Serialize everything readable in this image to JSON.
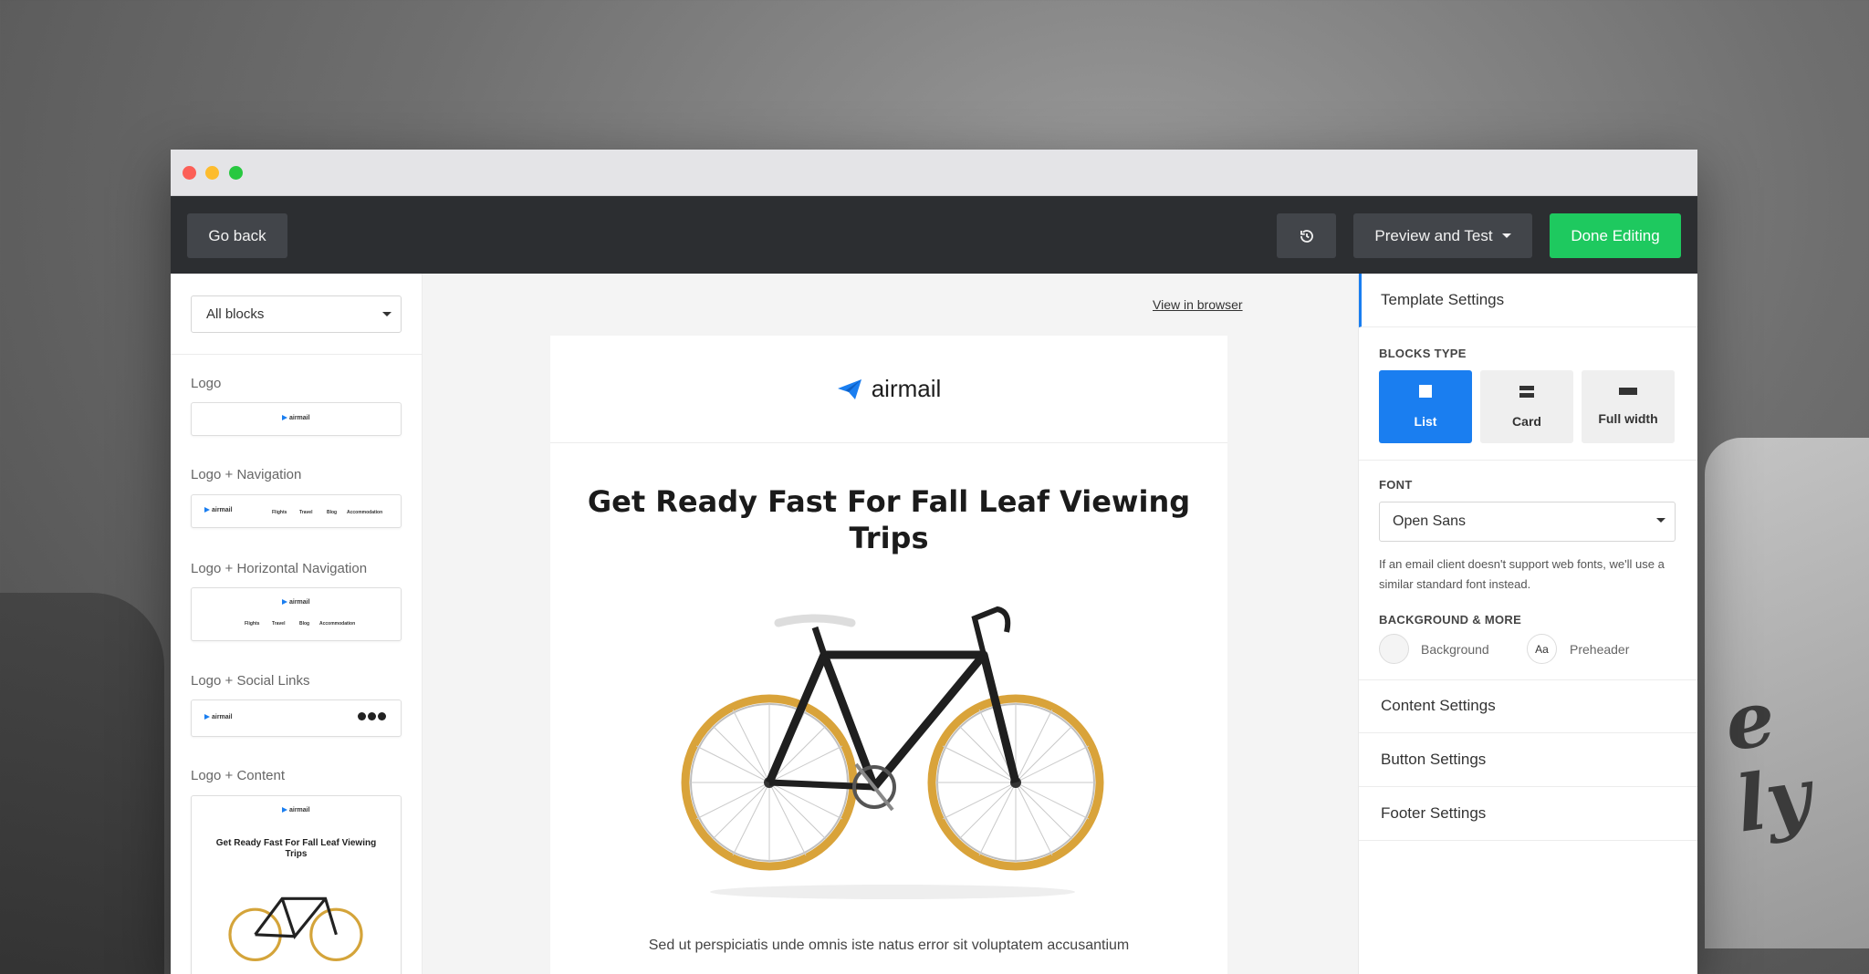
{
  "toolbar": {
    "go_back": "Go back",
    "preview_test": "Preview and Test",
    "done_editing": "Done Editing"
  },
  "sidebar": {
    "filter_select": "All blocks",
    "blocks": [
      {
        "label": "Logo"
      },
      {
        "label": "Logo + Navigation"
      },
      {
        "label": "Logo + Horizontal Navigation"
      },
      {
        "label": "Logo + Social Links"
      },
      {
        "label": "Logo + Content"
      }
    ],
    "mini_brand": "airmail",
    "mini_nav": [
      "Flights",
      "Travel",
      "Blog",
      "Accommodation"
    ],
    "mini_title": "Get Ready Fast For Fall Leaf Viewing Trips"
  },
  "canvas": {
    "view_in_browser": "View in browser",
    "brand": "airmail",
    "title": "Get Ready Fast For Fall Leaf Viewing Trips",
    "body_text": "Sed ut perspiciatis unde omnis iste natus error sit voluptatem accusantium"
  },
  "right_panel": {
    "template_settings": "Template Settings",
    "blocks_type_label": "BLOCKS TYPE",
    "block_types": [
      {
        "label": "List",
        "active": true
      },
      {
        "label": "Card",
        "active": false
      },
      {
        "label": "Full width",
        "active": false
      }
    ],
    "font_label": "FONT",
    "font_value": "Open Sans",
    "font_note": "If an email client doesn't support web fonts, we'll use a similar standard font instead.",
    "background_more_label": "BACKGROUND & MORE",
    "background_label": "Background",
    "preheader_swatch": "Aa",
    "preheader_label": "Preheader",
    "content_settings": "Content Settings",
    "button_settings": "Button Settings",
    "footer_settings": "Footer Settings"
  },
  "colors": {
    "accent": "#1a7ef0",
    "done_green": "#1ec95f",
    "toolbar_dark": "#2c2e31"
  }
}
